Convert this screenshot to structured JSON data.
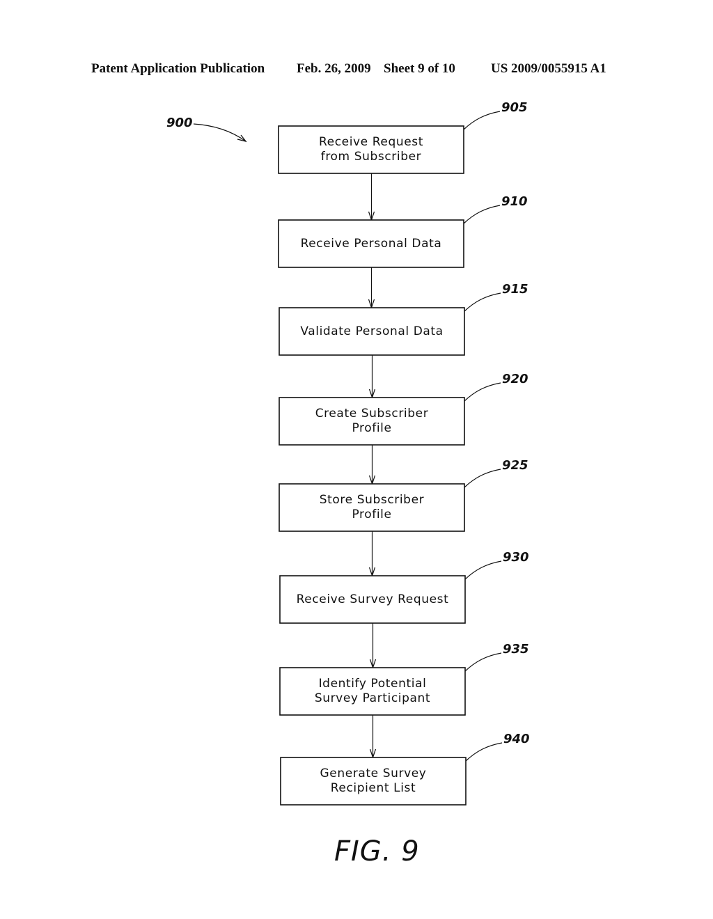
{
  "header": {
    "publication": "Patent Application Publication",
    "date": "Feb. 26, 2009",
    "sheet": "Sheet 9 of 10",
    "number": "US 2009/0055915 A1"
  },
  "diagram": {
    "ref_label": "900",
    "figure_label": "FIG.  9",
    "steps": [
      {
        "ref": "905",
        "line1": "Receive Request",
        "line2": "from Subscriber"
      },
      {
        "ref": "910",
        "line1": "Receive Personal Data",
        "line2": ""
      },
      {
        "ref": "915",
        "line1": "Validate Personal Data",
        "line2": ""
      },
      {
        "ref": "920",
        "line1": "Create Subscriber",
        "line2": "Profile"
      },
      {
        "ref": "925",
        "line1": "Store Subscriber",
        "line2": "Profile"
      },
      {
        "ref": "930",
        "line1": "Receive Survey Request",
        "line2": ""
      },
      {
        "ref": "935",
        "line1": "Identify Potential",
        "line2": "Survey Participant"
      },
      {
        "ref": "940",
        "line1": "Generate Survey",
        "line2": "Recipient List"
      }
    ]
  }
}
